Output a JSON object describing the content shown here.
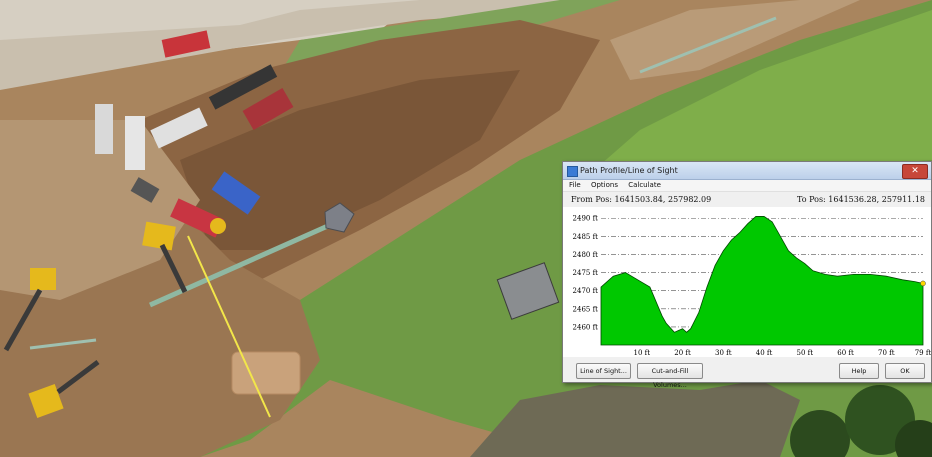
{
  "window": {
    "title": "Path Profile/Line of Sight",
    "close_label": "✕"
  },
  "menu": [
    "File",
    "Options",
    "Calculate"
  ],
  "positions": {
    "from": "From Pos: 1641503.84, 257982.09",
    "to": "To Pos: 1641536.28, 257911.18"
  },
  "buttons": {
    "line_of_sight": "Line of Sight...",
    "cut_fill": "Cut-and-Fill Volumes...",
    "help": "Help",
    "ok": "OK"
  },
  "colors": {
    "profile_fill": "#00c800",
    "profile_stroke": "#004800",
    "marker": "#ffd700",
    "sight_line": "#f2e64a"
  },
  "chart_data": {
    "type": "area",
    "title": "",
    "xlabel": "",
    "ylabel": "",
    "x_ticks": [
      10,
      20,
      30,
      40,
      50,
      60,
      70,
      79
    ],
    "x_tick_labels": [
      "10 ft",
      "20 ft",
      "30 ft",
      "40 ft",
      "50 ft",
      "60 ft",
      "70 ft",
      "79 ft"
    ],
    "y_ticks": [
      2460,
      2465,
      2470,
      2475,
      2480,
      2485,
      2490
    ],
    "y_tick_labels": [
      "2460 ft",
      "2465 ft",
      "2470 ft",
      "2475 ft",
      "2480 ft",
      "2485 ft",
      "2490 ft"
    ],
    "xlim": [
      0,
      79
    ],
    "ylim": [
      2455,
      2492
    ],
    "grid": "horizontal dashed",
    "x": [
      0,
      3,
      6,
      9,
      12,
      15,
      16,
      18,
      19,
      20,
      21,
      22,
      24,
      26,
      28,
      30,
      32,
      34,
      36,
      38,
      40,
      42,
      44,
      46,
      48,
      50,
      52,
      55,
      58,
      62,
      66,
      70,
      74,
      77,
      79
    ],
    "y": [
      2471,
      2474,
      2475,
      2473,
      2471,
      2463,
      2461,
      2458.5,
      2459,
      2459.5,
      2458.5,
      2459.5,
      2464,
      2471,
      2477,
      2481,
      2484,
      2486,
      2488.5,
      2490.5,
      2490.5,
      2489,
      2485,
      2481,
      2479,
      2477.5,
      2475.5,
      2474.5,
      2474,
      2474.5,
      2474.5,
      2474,
      2473,
      2472.5,
      2472
    ]
  }
}
